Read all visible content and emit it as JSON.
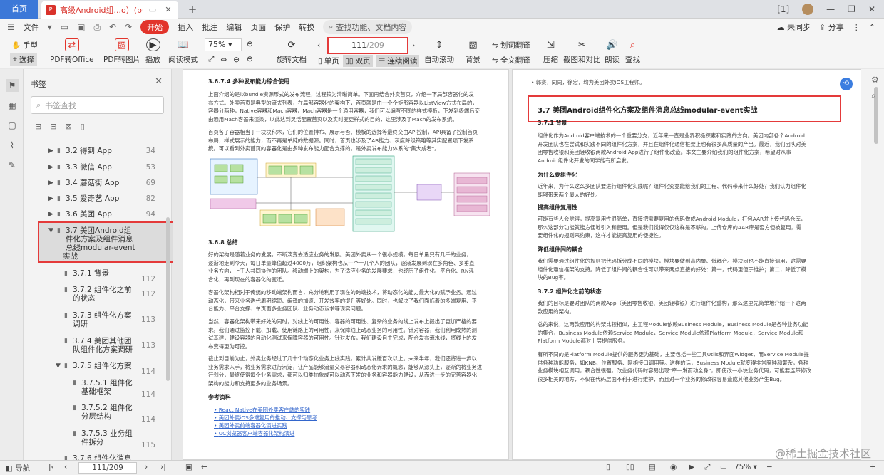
{
  "tabs": {
    "home": "首页",
    "doc": "高级Android组...o）(bu).pdf"
  },
  "menu": {
    "file": "文件",
    "items": [
      "开始",
      "插入",
      "批注",
      "编辑",
      "页面",
      "保护",
      "转换"
    ],
    "search": "查找功能、文档内容",
    "sync": "未同步",
    "share": "分享"
  },
  "ribbon": {
    "hand": "手型",
    "select": "选择",
    "pdf2office": "PDF转Office",
    "pdf2img": "PDF转图片",
    "play": "播放",
    "read": "阅读模式",
    "zoom": "75%",
    "rotate": "旋转文档",
    "page_current": "111",
    "page_total": "/209",
    "single": "单页",
    "double": "双页",
    "continuous": "连续阅读",
    "autoscroll": "自动滚动",
    "background": "背景",
    "word_translate": "划词翻译",
    "full_translate": "全文翻译",
    "compress": "压缩",
    "screenshot": "截图和对比",
    "readaloud": "朗读",
    "find": "查找"
  },
  "panel": {
    "title": "书签",
    "search_placeholder": "书签查找",
    "items": [
      {
        "label": "3.2 得到 App",
        "page": "34"
      },
      {
        "label": "3.3 微信 App",
        "page": "53"
      },
      {
        "label": "3.4 蘑菇街 App",
        "page": "69"
      },
      {
        "label": "3.5 爱奇艺 App",
        "page": "82"
      },
      {
        "label": "3.6 美团 App",
        "page": "94"
      },
      {
        "label": "3.7 美团Android组",
        "label2": "件化方案及组件消息",
        "label3": "总线modular-event",
        "label4": "实战",
        "page": "112"
      },
      {
        "label": "3.7.1 背景",
        "page": "112"
      },
      {
        "label": "3.7.2 组件化之前",
        "label2": "的状态",
        "page": "112"
      },
      {
        "label": "3.7.3 组件化方案",
        "label2": "调研",
        "page": "113"
      },
      {
        "label": "3.7.4 美团其他团",
        "label2": "队组件化方案调研",
        "page": "113"
      },
      {
        "label": "3.7.5 组件化方案",
        "page": "114"
      },
      {
        "label": "3.7.5.1 组件化",
        "label2": "基础框架",
        "page": "114"
      },
      {
        "label": "3.7.5.2 组件化",
        "label2": "分层结构",
        "page": "114"
      },
      {
        "label": "3.7.5.3 业务组",
        "label2": "件拆分",
        "page": "115"
      },
      {
        "label": "3.7.6 组件化消息",
        "page": ""
      }
    ]
  },
  "left_page": {
    "h1": "3.6.7.4 多种发布能力综合使用",
    "p1": [
      "上面介绍的是以bundle资源形式的发布流程，过程较为清晰简单。下面再结合外卖首页，介绍一下局部容器化的发",
      "布方式。外卖首页是典型的流式列表，在局部容器化的架构下，首页就是由一个个矩形容器以ListView方式布局的，",
      "容器分两种，Native容器和Mach容器，Mach容器是一个通用容器，我们可以编写不同的样式模板，下发到终端后交",
      "由通用Mach容器来渲染，以此达到灵活配置首页以及实时变更样式的目的，这里涉及了Mach的发布系统。"
    ],
    "p2": [
      "首页各子容器相当于一块块积木，它们的位置排布、展示与否、模板的选择等最终交由API控制，API具备了控制首页",
      "布局，样式展示的能力，而不再是单纯的数据源。同时，首页也涉及了AB能力、灰度降级策略等其实配置项下发系",
      "统。可以看到外卖首页的容器化是由多种发布能力配合支撑的，是外卖发布能力体系的\"集大成者\"。"
    ],
    "h2": "3.6.8 总结",
    "p3": [
      "好的架构是随着业务的发展，不断演变去适应业务的发展。美团外卖从一个很小规模，每日单量只有几千的业务，",
      "逐渐地走到今天，每日单量峰值超过4000万，组织架构也从一个十几个人的团队，逐渐发展到现在多角色、多垂直",
      "业务方向，上千人共同协作的团队。移动端上的架构，为了适应业务的发展要求，也经历了组件化、平台化、RN混",
      "合化，再到现在的容器化的变迁。"
    ],
    "p4": [
      "容器化架构相对于传统的移动端架构而言，充分地利用了现在的跨端技术，将动态化的能力最大化的赋予业务。通过",
      "动态化，带来业务迭代周期缩短、编译的加速、开发效率的提升等好处。同时，也解决了我们面临着的多端复用、平",
      "台能力、平台支撑、单页面多业务团队、业务动态诉求等现实问题。"
    ],
    "p5": [
      "当然，容器化架构带来好处的同时，对线上的可用性、容器的可用性、复杂的业务的线上发布上提出了更加严格的要",
      "求。我们通过监控下载、加载、使用链路上的可用性，来保障线上动态业务的可用性。针对容器，我们利用成熟的测",
      "试基建，建设容器的自动化测试来保障容器的可用性。针对发布，我们建设自主完成，配合发布流水线，将线上的发",
      "布变得更为可控。"
    ],
    "p6": [
      "截止到目前为止，外卖业务经过了几十个动态化业务上线实践，累计共发版百次以上。未来半年，我们还将进一步以",
      "业务需求入手，将业务需求进行沉淀，让产品能够流量交易容器和动态化诉求的概念，能够从源头上，逐渐的将业务进",
      "行划分，最终使得每个业务需求，都可以归类抽象成可以动态下发的业务和容器能力建设，从而进一步的完善容器化",
      "架构的能力和支持更多的业务场景。"
    ],
    "h3": "参考资料",
    "refs": [
      "React Native在美团外卖客户端的实践",
      "美团外卖iOS多端复用的推动、支撑与思考",
      "美团外卖前端容器化演进实践",
      "UC浏览器客户端容器化架构演进"
    ]
  },
  "right_page": {
    "top": "• 郭赛，同同，徐宏，均为美团外卖iOS工程师。",
    "title": "3.7 美团Android组件化方案及组件消息总线modular-event实战",
    "h1": "3.7.1 背景",
    "p1": [
      "组件化作为Android客户端技术的一个重要分支，近年来一直是业界积极探索和实践的方向。美团内部各个Android",
      "开发团队也在尝试和实践不同的组件化方案，并且在组件化通信框架上也有很多高质量的产出。最近，我们团队对美",
      "团零售收银和美团轻收银两款Android App进行了组件化改造。本文主要介绍我们的组件化方案，希望对从事",
      "Android组件化开发的同学能有所启发。"
    ],
    "h2": "为什么要组件化",
    "p2": [
      "近年来，为什么这么多团队要进行组件化实践呢？组件化究竟能给我们的工程、代码带来什么好处？我们认为组件化",
      "能够带来两个最大的好处。"
    ],
    "h3": "提高组件复用性",
    "p3": [
      "可能有些人会觉得，提高复用性很简单，直接把需要复用的代码做成Android Module，打包AAR并上传代码仓库，",
      "那么这部分功能就能方便地引入和使用。但是我们觉得仅仅这样是不够的，上传仓库的AAR库是否方便被复用，需",
      "要组件化的规则来约束，这样才能提高复用的便捷性。"
    ],
    "h4": "降低组件间的耦合",
    "p4": [
      "我们需要通过组件化的规则把代码拆分成不同的模块，模块要做到高内聚、低耦合。模块间也不能直接调用，这需要",
      "组件化通信框架的支持。降低了组件间的耦合性可以带来两点直接的好处：第一，代码更便于维护；第二，降低了模",
      "块的Bug率。"
    ],
    "h5": "3.7.2 组件化之前的状态",
    "p5": [
      "我们的目标是要对团队的两款App（美团零售收银、美团轻收银）进行组件化重构，那么这里先简单地介绍一下这两",
      "款应用的架构。"
    ],
    "p6": [
      "总的来说，这两款应用的构架比较相似，主工程Module依赖Business Module，Business Module是各种业务功能",
      "的集合，Business Module依赖Service Module，Service Module依赖Platform Module，Service Module和",
      "Platform Module都对上层提供服务。"
    ],
    "p7": [
      "有所不同的是Platform Module提供的服务更为基础，主要包括一些工具Utils和界面Widget，而Service Module提",
      "供各种功能服务，如KNB、位置服务、网络接口调用等。这样的话，Business Module就变得非常臃肿和繁杂，各种",
      "业务模块相互调用，耦合性很强，改业务代码时容易出现\"牵一发而动全身\"，即使改一小块业务代码，可能要连带修改",
      "很多相关的地方，不仅在代码层面不利于进行维护，而且对一个业务的修改很容易造成其他业务产生Bug。"
    ]
  },
  "status": {
    "nav": "导航",
    "page": "111/209",
    "zoom": "75%",
    "watermark": "@稀土掘金技术社区"
  }
}
